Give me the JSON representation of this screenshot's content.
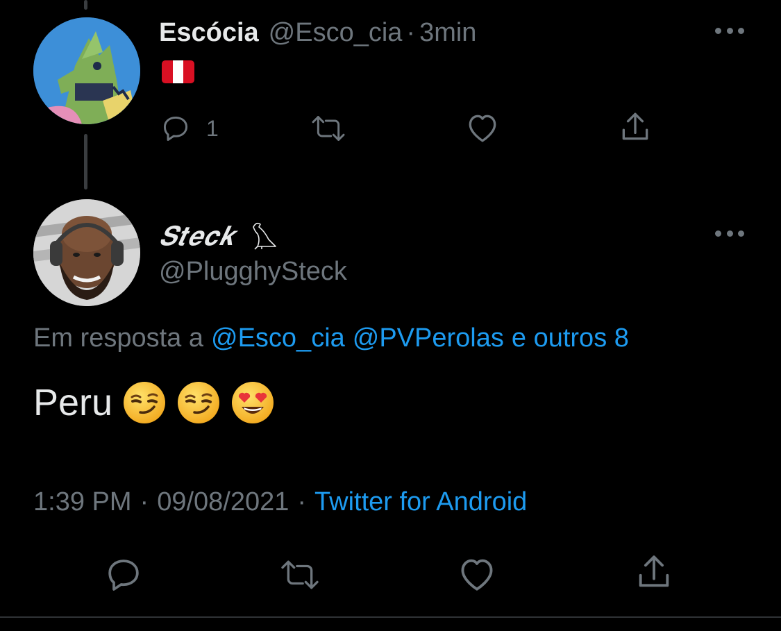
{
  "parent_tweet": {
    "display_name": "Escócia",
    "handle": "@Esco_cia",
    "separator": "·",
    "time_ago": "3min",
    "content_emoji": "peru-flag",
    "reply_count": "1",
    "icons": [
      "reply-icon",
      "retweet-icon",
      "like-icon",
      "share-icon",
      "more-icon"
    ]
  },
  "reply_tweet": {
    "display_name": "𝑺𝒕𝒆𝒄𝒌",
    "name_emoji": "bird-hieroglyph-icon",
    "handle": "@PlugghySteck",
    "reply_prefix": "Em resposta a",
    "reply_mention_1": "@Esco_cia",
    "reply_mention_2": "@PVPerolas",
    "reply_others": "e outros 8",
    "text": "Peru",
    "text_emojis": [
      "smirking-face",
      "smirking-face",
      "heart-eyes-face"
    ],
    "time": "1:39 PM",
    "date": "09/08/2021",
    "separator": "·",
    "source": "Twitter for Android"
  },
  "colors": {
    "background": "#000000",
    "primary_text": "#e7e9ea",
    "muted_text": "#6e767d",
    "link": "#1d9bf0"
  }
}
